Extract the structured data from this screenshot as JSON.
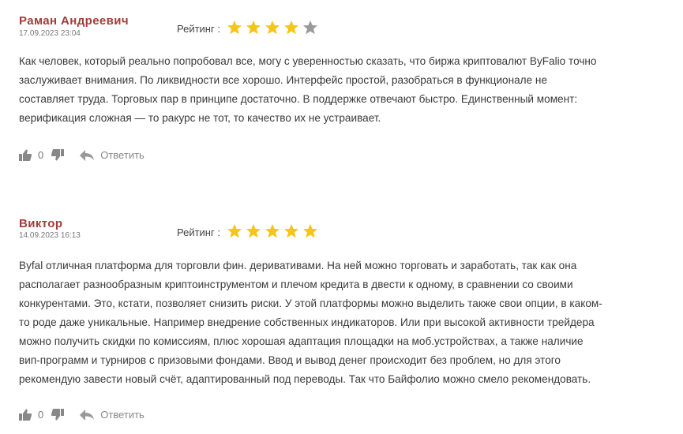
{
  "rating_label": "Рейтинг :",
  "reply_label": "Ответить",
  "colors": {
    "author": "#a23b3b",
    "star_filled": "#f5c518",
    "star_empty": "#9a9a9a",
    "icon": "#888888"
  },
  "reviews": [
    {
      "author": "Раман Андреевич",
      "date": "17.09.2023 23:04",
      "rating": 4,
      "rating_max": 5,
      "text_lines": [
        "Как человек, который реально попробовал все, могу с уверенностью сказать, что биржа криптовалют ByFalio точно",
        "заслуживает внимания. По ликвидности все хорошо. Интерфейс простой, разобраться в функционале не",
        "составляет труда. Торговых пар в принципе достаточно. В поддержке отвечают быстро. Единственный момент:",
        "верификация сложная — то ракурс не тот, то качество их не устраивает."
      ],
      "likes": "0"
    },
    {
      "author": "Виктор",
      "date": "14.09.2023 16:13",
      "rating": 5,
      "rating_max": 5,
      "text_lines": [
        "Byfal отличная платформа для торговли фин. деривативами. На ней можно торговать и заработать, так как она",
        "располагает разнообразным криптоинструментом и плечом кредита в двести к одному, в сравнении со своими",
        "конкурентами. Это, кстати, позволяет снизить риски. У этой платформы можно выделить также свои опции, в каком-",
        "то роде даже уникальные. Например внедрение собственных индикаторов. Или при высокой активности трейдера",
        "можно получить скидки по комиссиям, плюс хорошая адаптация площадки на моб.устройствах, а также наличие",
        "вип-программ и турниров с призовыми фондами. Ввод и вывод денег происходит без проблем, но для этого",
        "рекомендую завести новый счёт, адаптированный под переводы. Так что Байфолио можно смело рекомендовать."
      ],
      "likes": "0"
    }
  ]
}
